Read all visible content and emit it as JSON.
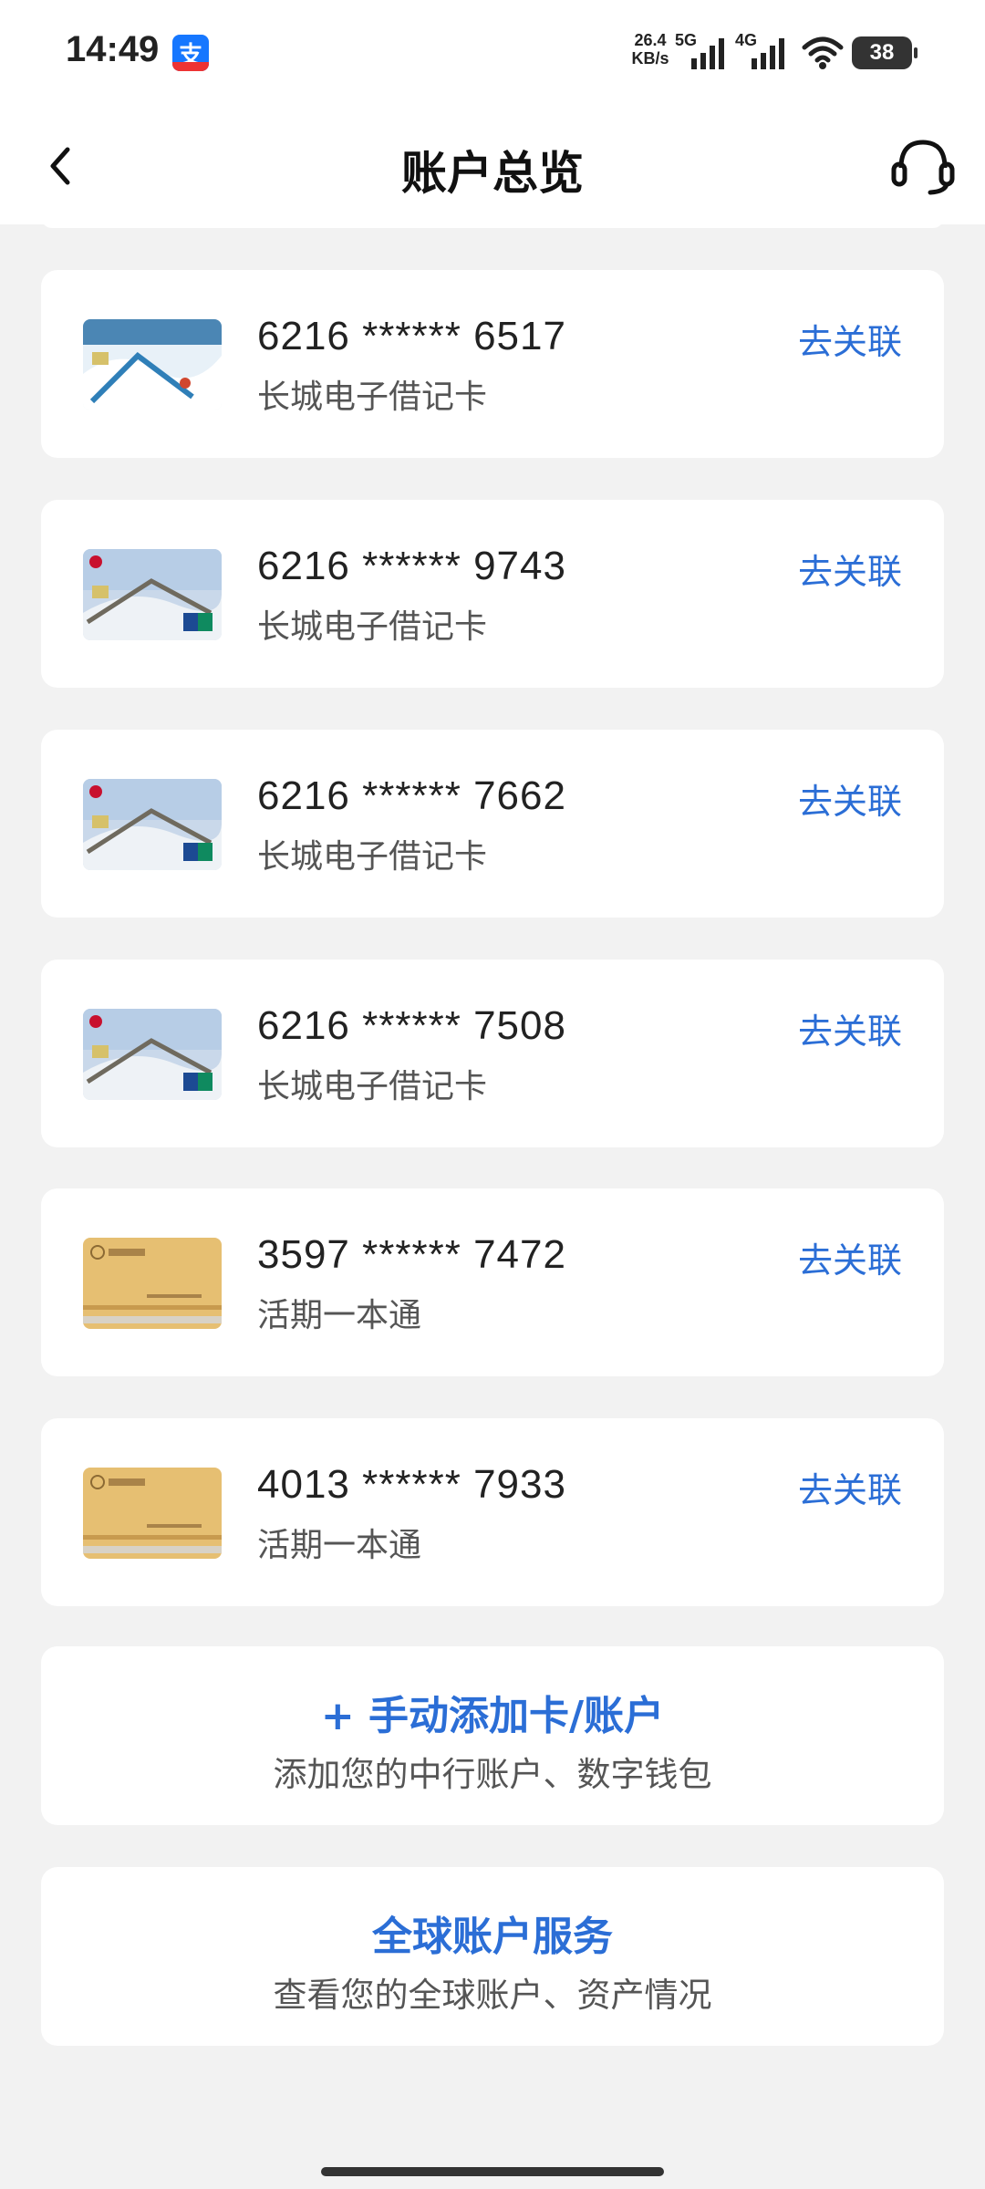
{
  "status_bar": {
    "time": "14:49",
    "app_badge": "支",
    "net_speed_value": "26.4",
    "net_speed_unit": "KB/s",
    "net_5g": "5G",
    "net_4g": "4G",
    "battery": "38"
  },
  "header": {
    "title": "账户总览",
    "back_icon": "chevron-left-icon",
    "support_icon": "headset-icon"
  },
  "cards": [
    {
      "number": "6216 ****** 6517",
      "type": "长城电子借记卡",
      "action": "去关联",
      "style": "skiing"
    },
    {
      "number": "6216 ****** 9743",
      "type": "长城电子借记卡",
      "action": "去关联",
      "style": "greatwall"
    },
    {
      "number": "6216 ****** 7662",
      "type": "长城电子借记卡",
      "action": "去关联",
      "style": "greatwall"
    },
    {
      "number": "6216 ****** 7508",
      "type": "长城电子借记卡",
      "action": "去关联",
      "style": "greatwall"
    },
    {
      "number": "3597 ****** 7472",
      "type": "活期一本通",
      "action": "去关联",
      "style": "passbook"
    },
    {
      "number": "4013 ****** 7933",
      "type": "活期一本通",
      "action": "去关联",
      "style": "passbook"
    }
  ],
  "add_account": {
    "title": "+ 手动添加卡/账户",
    "subtitle": "添加您的中行账户、数字钱包"
  },
  "global_service": {
    "title": "全球账户服务",
    "subtitle": "查看您的全球账户、资产情况"
  },
  "colors": {
    "accent": "#2b6ed6",
    "background": "#f2f2f2",
    "card": "#ffffff"
  }
}
